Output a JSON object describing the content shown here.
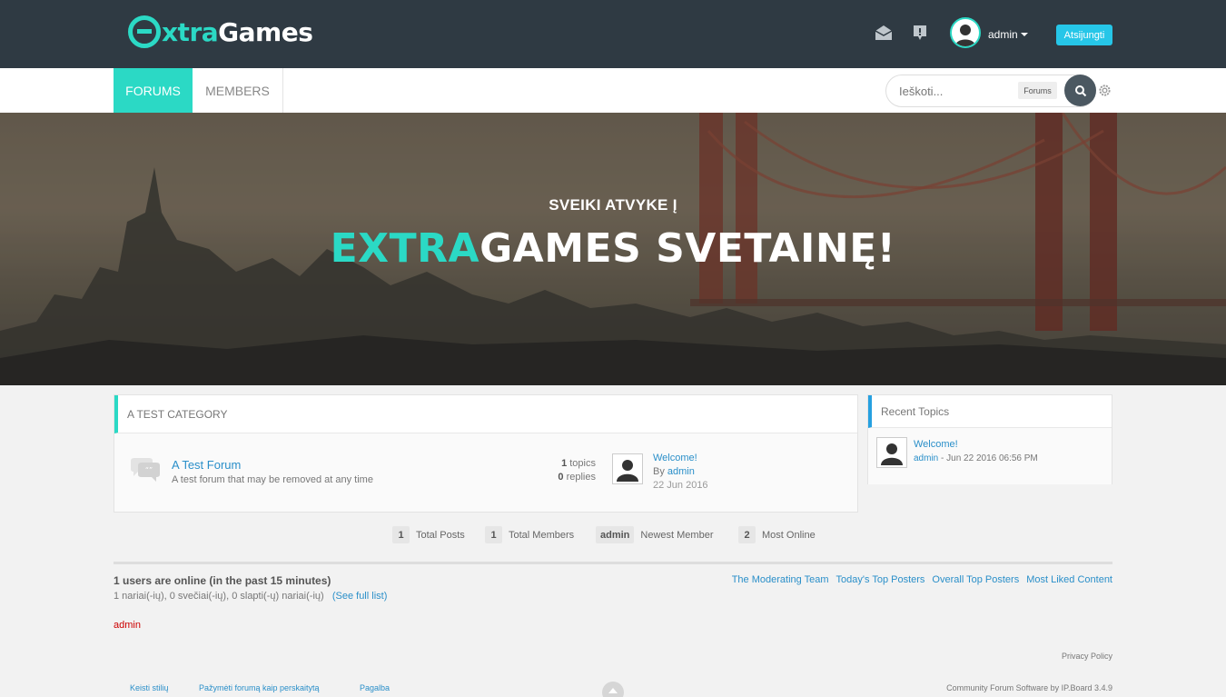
{
  "header": {
    "logo_e": "",
    "logo_extra": "xtra",
    "logo_games": "Games",
    "user_name": "admin",
    "logout_label": "Atsijungti",
    "accent_color": "#2bd9c5"
  },
  "nav": {
    "tabs": [
      {
        "label": "Forums",
        "active": true
      },
      {
        "label": "Members",
        "active": false
      }
    ],
    "search_placeholder": "Ieškoti...",
    "search_scope": "Forums"
  },
  "hero": {
    "subtitle": "SVEIKI ATVYKE Į",
    "title_accent": "EXTRA",
    "title_rest": "GAMES SVETAINĘ!"
  },
  "category": {
    "title": "A Test Category",
    "forum": {
      "name": "A Test Forum",
      "description": "A test forum that may be removed at any time",
      "topics_count": "1",
      "topics_label": "topics",
      "replies_count": "0",
      "replies_label": "replies",
      "last_post_title": "Welcome!",
      "last_post_by_label": "By",
      "last_post_author": "admin",
      "last_post_date": "22 Jun 2016"
    }
  },
  "sidebar": {
    "title": "Recent Topics",
    "topic_title": "Welcome!",
    "topic_author": "admin",
    "topic_date": " - Jun 22 2016 06:56 PM"
  },
  "stats": [
    {
      "value": "1",
      "label": "Total Posts"
    },
    {
      "value": "1",
      "label": "Total Members"
    },
    {
      "value": "admin",
      "label": "Newest Member"
    },
    {
      "value": "2",
      "label": "Most Online"
    }
  ],
  "online": {
    "title": "1 users are online (in the past 15 minutes)",
    "breakdown": "1 nariai(-ių), 0 svečiai(-ių), 0 slapti(-ų) nariai(-ių)",
    "full_list": "(See full list)",
    "users": "admin"
  },
  "quick_links": [
    "The Moderating Team",
    "Today's Top Posters",
    "Overall Top Posters",
    "Most Liked Content"
  ],
  "footer": {
    "privacy": "Privacy Policy",
    "links": [
      "Keisti stilių",
      "Pažymėti forumą kaip perskaitytą",
      "Pagalba"
    ],
    "copyright": "Community Forum Software by IP.Board 3.4.9"
  }
}
